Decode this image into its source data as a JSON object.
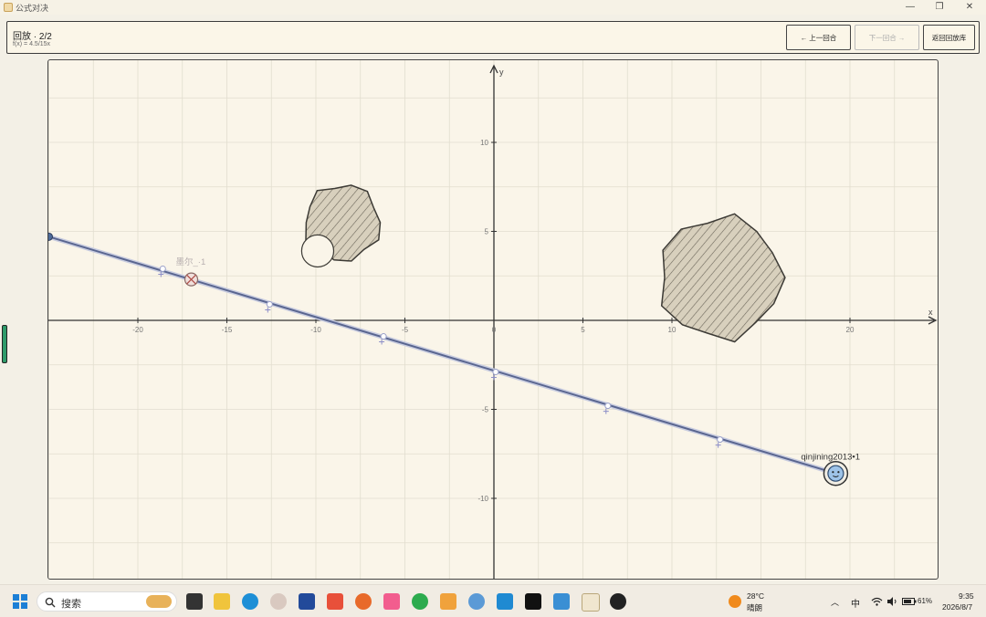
{
  "window": {
    "title": "公式对决"
  },
  "header": {
    "mode": "回放 · 2/2",
    "formula": "f(x) = 4.5/15x",
    "prev_label": "← 上一回合",
    "next_label": "下一回合 →",
    "back_label": "返回回放库"
  },
  "chart_data": {
    "type": "line",
    "xlabel": "x",
    "ylabel": "y",
    "xlim": [
      -25,
      25
    ],
    "ylim": [
      -14.5,
      14.5
    ],
    "grid": true,
    "x_ticks": [
      -20,
      -15,
      -10,
      -5,
      0,
      5,
      10,
      20
    ],
    "y_ticks": [
      10,
      5,
      -5,
      -10
    ],
    "tick_labels_x": [
      "-20",
      "-15",
      "-10",
      "-5",
      "0",
      "5",
      "10",
      "20"
    ],
    "tick_labels_y": [
      "10",
      "5",
      "-5",
      "-10"
    ],
    "series": [
      {
        "points": [
          [
            -25,
            4.7
          ],
          [
            19.2,
            -8.6
          ]
        ]
      }
    ],
    "markers": [
      [
        -18.6,
        2.9
      ],
      [
        -12.6,
        0.9
      ],
      [
        -6.2,
        -0.9
      ],
      [
        0.1,
        -2.9
      ],
      [
        6.4,
        -4.8
      ],
      [
        12.7,
        -6.7
      ]
    ],
    "obstacles": [
      {
        "shape": "blob",
        "center": [
          -8.5,
          5.5
        ],
        "radius": 2.3
      },
      {
        "shape": "blob",
        "center": [
          12.7,
          2.4
        ],
        "radius": 3.7
      }
    ],
    "players": [
      {
        "name": "墨尔_·1",
        "x": -17,
        "y": 2.3,
        "status": "eliminated"
      },
      {
        "name": "qinjining2013•1",
        "x": 19.2,
        "y": -8.6,
        "status": "shooter"
      }
    ]
  },
  "taskbar": {
    "search_label": "搜索",
    "weather_temp": "28°C",
    "weather_cond": "晴朗",
    "ime": "中",
    "battery": "61%",
    "time": "9:35",
    "date": "2026/8/7"
  },
  "colors": {
    "line": "#5a6690",
    "paper": "#faf5e9",
    "grid": "#e2ddcf",
    "accent": "#2e9b6a"
  }
}
